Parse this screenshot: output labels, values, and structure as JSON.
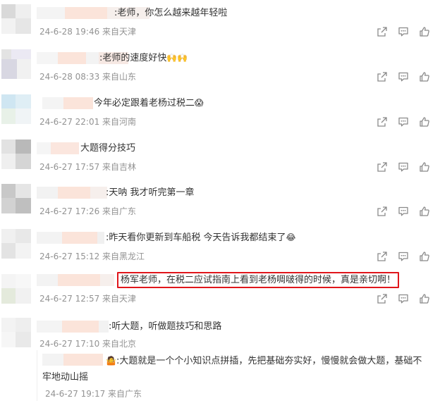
{
  "comments": [
    {
      "text": ":老师，你怎么越来越年轻啦",
      "meta": "24-6-28 19:46 来自天津"
    },
    {
      "text": ":老师的速度好快",
      "emoji": "🙌🙌",
      "meta": "24-6-28 08:33 来自山东"
    },
    {
      "text": "今年必定跟着老杨过税二",
      "emoji": "😱",
      "meta": "24-6-27 22:01 来自河南"
    },
    {
      "text": "大题得分技巧",
      "meta": "24-6-27 17:57 来自吉林"
    },
    {
      "text": ":天呐 我才听完第一章",
      "meta": "24-6-27 17:26 来自广东"
    },
    {
      "text": ":昨天看你更新到车船税 今天告诉我都结束了",
      "emoji": "😂",
      "meta": "24-6-27 15:12 来自黑龙江"
    },
    {
      "text": "杨军老师，在税二应试指南上看到老杨啁啵得的时候，真是亲切啊！",
      "meta": "24-6-27 12:57 来自天津"
    },
    {
      "text": ":听大题，听做题技巧和思路",
      "meta": "24-6-27 17:10 来自北京"
    }
  ],
  "reply": {
    "emoji": "🤷",
    "text_line1": ":大题就是一个个小知识点拼插，先把基础夯实好，慢慢就会做大题，基础不",
    "text_line2": "牢地动山摇",
    "meta": "24-6-27 19:17 来自广东"
  },
  "icons": [
    "share-icon",
    "comment-icon",
    "like-icon"
  ],
  "colors": {
    "highlight_border": "#e0161b",
    "meta_text": "#939393",
    "body_text": "#333333"
  }
}
